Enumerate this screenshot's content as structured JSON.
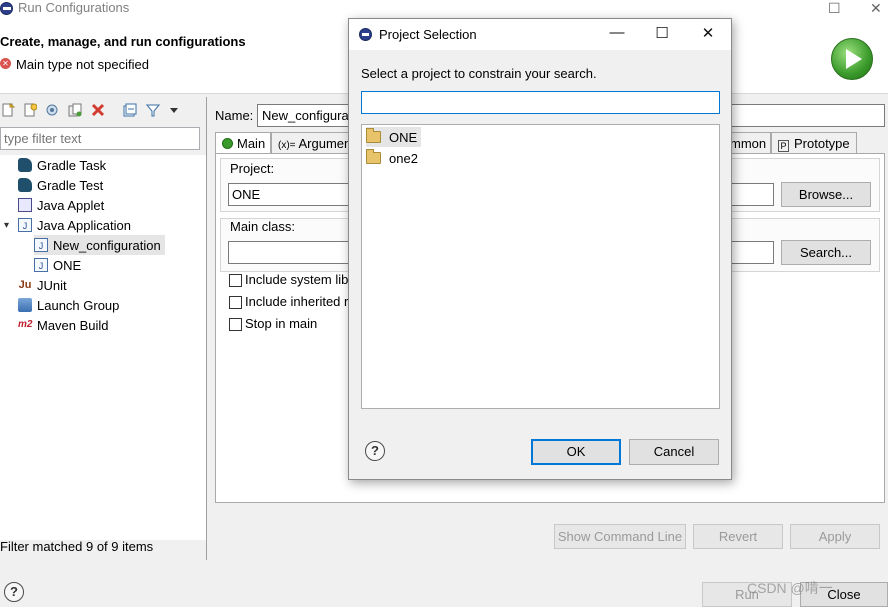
{
  "window": {
    "title": "Run Configurations",
    "controls": {
      "minimize": "—",
      "maximize": "☐",
      "close": "✕"
    }
  },
  "header": {
    "title": "Create, manage, and run configurations",
    "message": "Main type not specified",
    "message_icon": "error-icon"
  },
  "left_panel": {
    "toolbar_icons": [
      "new-configuration-icon",
      "new-prototype-icon",
      "export-icon",
      "duplicate-icon",
      "delete-icon",
      "collapse-all-icon",
      "filter-icon",
      "view-menu-icon"
    ],
    "filter_placeholder": "type filter text",
    "tree": [
      {
        "label": "Gradle Task",
        "icon": "gradle-icon",
        "level": 0
      },
      {
        "label": "Gradle Test",
        "icon": "gradle-icon",
        "level": 0
      },
      {
        "label": "Java Applet",
        "icon": "java-applet-icon",
        "level": 0
      },
      {
        "label": "Java Application",
        "icon": "java-application-icon",
        "level": 0,
        "expanded": true
      },
      {
        "label": "New_configuration",
        "icon": "java-application-icon",
        "level": 1,
        "selected": true
      },
      {
        "label": "ONE",
        "icon": "java-application-icon",
        "level": 1
      },
      {
        "label": "JUnit",
        "icon": "junit-icon",
        "level": 0
      },
      {
        "label": "Launch Group",
        "icon": "launch-group-icon",
        "level": 0
      },
      {
        "label": "Maven Build",
        "icon": "maven-icon",
        "level": 0
      }
    ],
    "status": "Filter matched 9 of 9 items"
  },
  "config_panel": {
    "name_label": "Name:",
    "name_value": "New_configura",
    "tabs": [
      {
        "label": "Main",
        "icon": "main-tab-icon",
        "active": true
      },
      {
        "label": "Argumen",
        "icon": "arguments-tab-icon"
      },
      {
        "label": "mmon",
        "icon": ""
      },
      {
        "label": "Prototype",
        "icon": "prototype-tab-icon"
      }
    ],
    "project_label": "Project:",
    "project_value": "ONE",
    "browse_button": "Browse...",
    "main_class_label": "Main class:",
    "main_class_value": "",
    "search_button": "Search...",
    "checkboxes": [
      {
        "label": "Include system lib",
        "checked": false
      },
      {
        "label": "Include inherited r",
        "checked": false
      },
      {
        "label": "Stop in main",
        "checked": false
      }
    ],
    "buttons": {
      "show_command_line": "Show Command Line",
      "revert": "Revert",
      "apply": "Apply",
      "run": "Run",
      "close": "Close"
    }
  },
  "dialog": {
    "title": "Project Selection",
    "controls": {
      "minimize": "—",
      "maximize": "☐",
      "close": "✕"
    },
    "prompt": "Select a project to constrain your search.",
    "search_value": "",
    "projects": [
      {
        "label": "ONE",
        "icon": "project-folder-icon",
        "selected": true
      },
      {
        "label": "one2",
        "icon": "project-folder-icon",
        "selected": false
      }
    ],
    "ok_button": "OK",
    "cancel_button": "Cancel"
  },
  "watermark": "CSDN @啃一"
}
